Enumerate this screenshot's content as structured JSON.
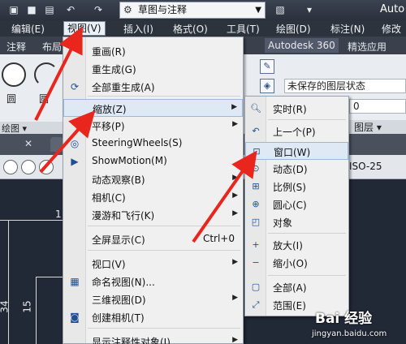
{
  "app": {
    "workspace": "草图与注释",
    "title_partial": "Auto"
  },
  "menubar": [
    "编辑(E)",
    "视图(V)",
    "插入(I)",
    "格式(O)",
    "工具(T)",
    "绘图(D)",
    "标注(N)",
    "修改"
  ],
  "ribbon_tabs": [
    "注释",
    "布局",
    "Autodesk 360",
    "精选应用"
  ],
  "ribbon": {
    "circle_label": "圆",
    "arc_label": "圆",
    "draw_panel": "绘图",
    "layer_state": "未保存的图层状态",
    "layer_value": "0",
    "layer_panel": "图层"
  },
  "toolbar": {
    "dimstyle": "ISO-25"
  },
  "canvas": {
    "dims": [
      "1",
      "34",
      "15"
    ]
  },
  "view_menu": {
    "items": [
      {
        "label": "重画(R)",
        "icon": "",
        "accel": "",
        "sub": false
      },
      {
        "label": "重生成(G)",
        "icon": "",
        "accel": "",
        "sub": false
      },
      {
        "label": "全部重生成(A)",
        "icon": "regen-all-icon",
        "accel": "",
        "sub": false
      },
      {
        "label": "缩放(Z)",
        "icon": "",
        "accel": "",
        "sub": true
      },
      {
        "label": "平移(P)",
        "icon": "",
        "accel": "",
        "sub": true
      },
      {
        "label": "SteeringWheels(S)",
        "icon": "steering-wheel-icon",
        "accel": "",
        "sub": false
      },
      {
        "label": "ShowMotion(M)",
        "icon": "showmotion-icon",
        "accel": "",
        "sub": false
      },
      {
        "label": "动态观察(B)",
        "icon": "",
        "accel": "",
        "sub": true
      },
      {
        "label": "相机(C)",
        "icon": "",
        "accel": "",
        "sub": true
      },
      {
        "label": "漫游和飞行(K)",
        "icon": "",
        "accel": "",
        "sub": true
      },
      {
        "label": "全屏显示(C)",
        "icon": "",
        "accel": "Ctrl+0",
        "sub": false
      },
      {
        "label": "视口(V)",
        "icon": "",
        "accel": "",
        "sub": true
      },
      {
        "label": "命名视图(N)...",
        "icon": "named-view-icon",
        "accel": "",
        "sub": false
      },
      {
        "label": "三维视图(D)",
        "icon": "",
        "accel": "",
        "sub": true
      },
      {
        "label": "创建相机(T)",
        "icon": "camera-icon",
        "accel": "",
        "sub": false
      },
      {
        "label": "显示注释性对象(I)",
        "icon": "",
        "accel": "",
        "sub": true
      }
    ]
  },
  "zoom_submenu": {
    "items": [
      {
        "label": "实时(R)",
        "icon": "zoom-realtime-icon"
      },
      {
        "label": "上一个(P)",
        "icon": "zoom-previous-icon"
      },
      {
        "label": "窗口(W)",
        "icon": "zoom-window-icon"
      },
      {
        "label": "动态(D)",
        "icon": "zoom-dynamic-icon"
      },
      {
        "label": "比例(S)",
        "icon": "zoom-scale-icon"
      },
      {
        "label": "圆心(C)",
        "icon": "zoom-center-icon"
      },
      {
        "label": "对象",
        "icon": "zoom-object-icon"
      },
      {
        "label": "放大(I)",
        "icon": "zoom-in-icon"
      },
      {
        "label": "缩小(O)",
        "icon": "zoom-out-icon"
      },
      {
        "label": "全部(A)",
        "icon": "zoom-all-icon"
      },
      {
        "label": "范围(E)",
        "icon": "zoom-extents-icon"
      }
    ]
  },
  "watermark": {
    "main": "Bai 经验",
    "sub": "jingyan.baidu.com"
  },
  "colors": {
    "highlight": "#dfe9f5",
    "arrow": "#e8261d",
    "menubar": "#2d333d"
  }
}
